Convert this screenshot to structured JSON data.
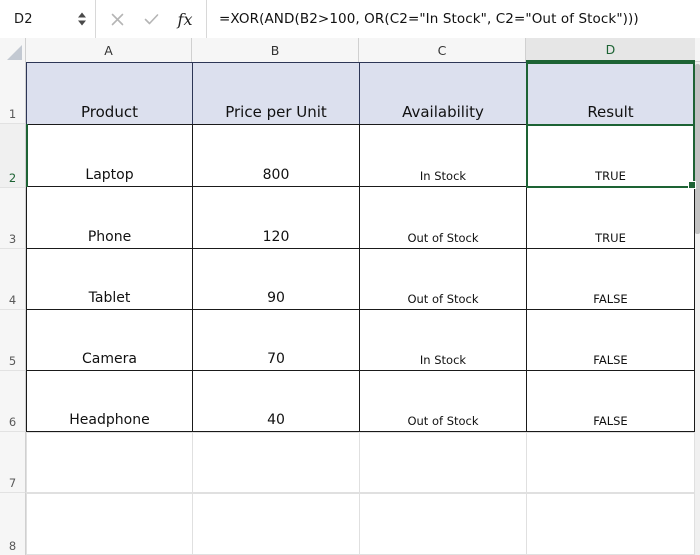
{
  "app": {
    "type": "spreadsheet"
  },
  "formula_bar": {
    "name_box_value": "D2",
    "name_box_placeholder": "Name Box",
    "cancel_icon": "close-icon",
    "enter_icon": "check-icon",
    "function_icon": "fx-icon",
    "function_label": "fx",
    "formula": "=XOR(AND(B2>100, OR(C2=\"In Stock\", C2=\"Out of Stock\")))",
    "formula_placeholder": "Enter formula"
  },
  "grid": {
    "columns": [
      {
        "letter": "A",
        "selected": false
      },
      {
        "letter": "B",
        "selected": false
      },
      {
        "letter": "C",
        "selected": false
      },
      {
        "letter": "D",
        "selected": true
      }
    ],
    "row_numbers": [
      "1",
      "2",
      "3",
      "4",
      "5",
      "6",
      "7",
      "8"
    ],
    "selected_row": "2",
    "selected_cell": "D2",
    "header_row": {
      "number": "1",
      "cells": [
        "Product",
        "Price per Unit",
        "Availability",
        "Result"
      ]
    },
    "data_rows": [
      {
        "number": "2",
        "product": "Laptop",
        "price": "800",
        "availability": "In Stock",
        "result": "TRUE"
      },
      {
        "number": "3",
        "product": "Phone",
        "price": "120",
        "availability": "Out of Stock",
        "result": "TRUE"
      },
      {
        "number": "4",
        "product": "Tablet",
        "price": "90",
        "availability": "Out of Stock",
        "result": "FALSE"
      },
      {
        "number": "5",
        "product": "Camera",
        "price": "70",
        "availability": "In Stock",
        "result": "FALSE"
      },
      {
        "number": "6",
        "product": "Headphone",
        "price": "40",
        "availability": "Out of Stock",
        "result": "FALSE"
      }
    ],
    "empty_rows": [
      {
        "number": "7"
      },
      {
        "number": "8"
      }
    ]
  },
  "colors": {
    "selection_green": "#1d6334",
    "header_fill": "#dce0ee",
    "header_border": "#2d3656",
    "grid_line": "#1a1a1a",
    "empty_grid_line": "#e0e0e0"
  }
}
